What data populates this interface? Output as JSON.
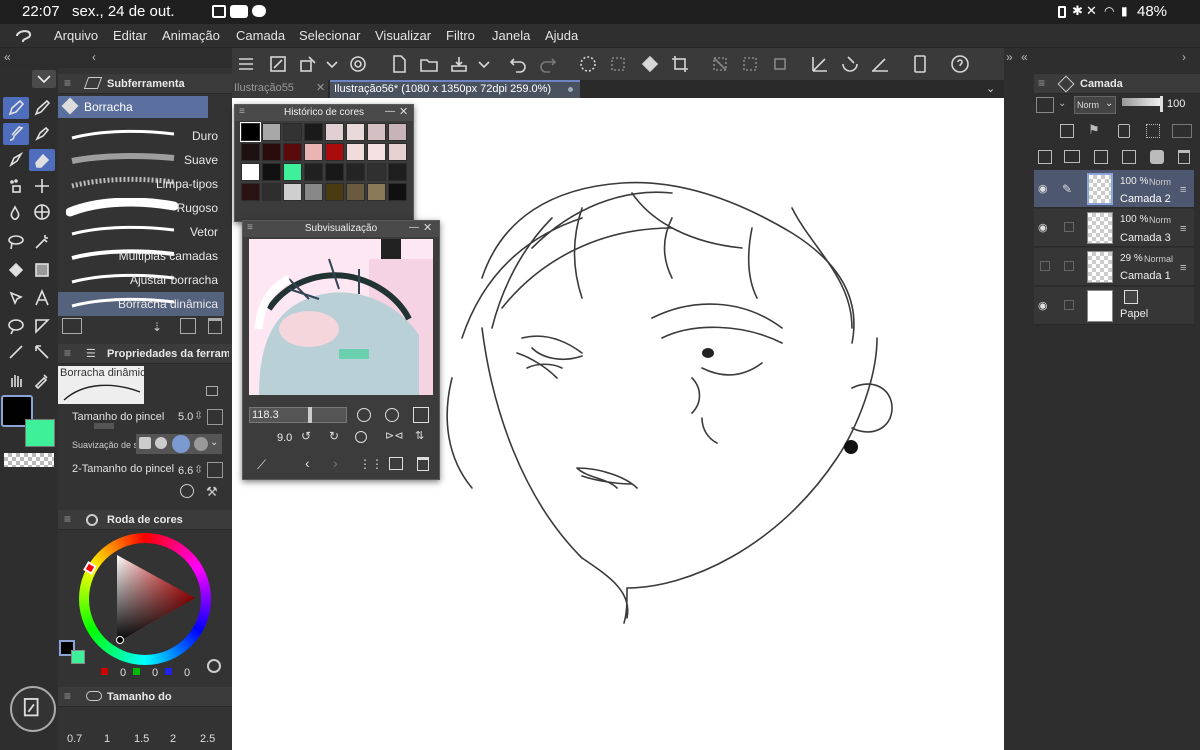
{
  "status": {
    "time": "22:07",
    "date": "sex., 24 de out.",
    "battery": "48%"
  },
  "menu": [
    "Arquivo",
    "Editar",
    "Animação",
    "Camada",
    "Selecionar",
    "Visualizar",
    "Filtro",
    "Janela",
    "Ajuda"
  ],
  "subtool": {
    "title": "Subferramenta",
    "group": "Borracha",
    "items": [
      "Duro",
      "Suave",
      "Limpa-tipos",
      "Rugoso",
      "Vetor",
      "Múltiplas camadas",
      "Ajustar borracha",
      "Borracha dinâmica"
    ]
  },
  "props": {
    "title": "Propriedades da ferramen",
    "preset": "Borracha dinâmica",
    "brush_size_label": "Tamanho do pincel",
    "brush_size": "5.0",
    "smoothing_label": "Suavização de s",
    "brush_size2_label": "2-Tamanho do pincel",
    "brush_size2": "6.6"
  },
  "colorwheel": {
    "title": "Roda de cores",
    "r": "0",
    "g": "0",
    "b": "0"
  },
  "brushsize": {
    "title": "Tamanho do",
    "ticks": [
      "0.7",
      "1",
      "1.5",
      "2",
      "2.5"
    ]
  },
  "tabs": [
    {
      "label": "Ilustração55",
      "active": false
    },
    {
      "label": "Ilustração56* (1080 x 1350px 72dpi 259.0%)",
      "active": true
    }
  ],
  "history": {
    "title": "Histórico de cores"
  },
  "subview": {
    "title": "Subvisualização",
    "zoom": "118.3",
    "angle": "9.0"
  },
  "layers": {
    "title": "Camada",
    "blend": "Norm",
    "opacity": "100",
    "rows": [
      {
        "percent": "100 %",
        "mode": "Norm",
        "name": "Camada 2",
        "selected": true
      },
      {
        "percent": "100 %",
        "mode": "Norm",
        "name": "Camada 3",
        "selected": false
      },
      {
        "percent": "29 %",
        "mode": "Normal",
        "name": "Camada 1",
        "selected": false
      },
      {
        "percent": "",
        "mode": "",
        "name": "Papel",
        "selected": false
      }
    ]
  },
  "colors": {
    "accent": "#4f6dbd",
    "main_color": "#000000",
    "sub_color": "#3ef09a",
    "history_swatches": [
      "#000000",
      "#a8a8a8",
      "#333333",
      "#1a1a1a",
      "#e0d0d4",
      "#e8dada",
      "#d4c0c4",
      "#c8b4b8",
      "#1c1010",
      "#2b0c0c",
      "#5a0a0a",
      "#e8b4b4",
      "#a80c0c",
      "#f0dcdc",
      "#f4e0e0",
      "#e6d0d0",
      "#ffffff",
      "#111111",
      "#3ef09a",
      "#202020",
      "#181818",
      "#242424",
      "#303030",
      "#1e1e1e",
      "#2a1212",
      "#2e2e2e",
      "#cfcfcf",
      "#888888",
      "#4a3c10",
      "#6a5a40",
      "#8a7a5a",
      "#101010"
    ]
  }
}
